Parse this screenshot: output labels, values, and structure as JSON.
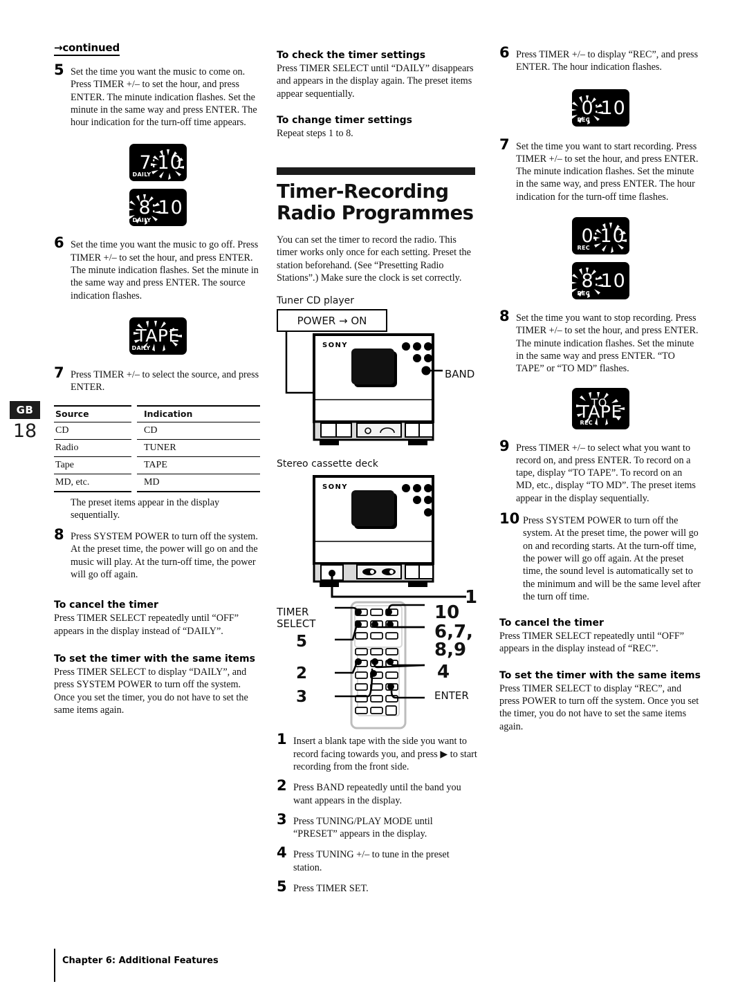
{
  "page": {
    "locale_tab": "GB",
    "number": "18",
    "footer": "Chapter 6: Additional Features"
  },
  "left_column": {
    "continued_label": "→continued",
    "step5": {
      "num": "5",
      "text": "Set the time you want the music to come on.\nPress TIMER +/– to set the hour, and press ENTER.\nThe minute indication flashes.\nSet the minute in the same way and press ENTER.\nThe hour indication for the turn-off time appears."
    },
    "display_710": {
      "hour": "7",
      "colon": ":",
      "minute": "10",
      "tag": "DAILY",
      "flashing": "minute"
    },
    "display_810": {
      "hour": "8",
      "colon": ":",
      "minute": "10",
      "tag": "DAILY",
      "flashing": "hour"
    },
    "step6": {
      "num": "6",
      "text": "Set the time you want the music to go off.\nPress TIMER +/– to set the hour, and press ENTER.\nThe minute indication flashes.\nSet the minute in the same way and press ENTER.\nThe source indication flashes."
    },
    "display_tape": {
      "word": "TAPE",
      "tag": "DAILY",
      "flashing": "word"
    },
    "step7": {
      "num": "7",
      "text": "Press TIMER +/– to select the source, and press ENTER."
    },
    "source_table": {
      "headers": [
        "Source",
        "Indication"
      ],
      "rows": [
        [
          "CD",
          "CD"
        ],
        [
          "Radio",
          "TUNER"
        ],
        [
          "Tape",
          "TAPE"
        ],
        [
          "MD, etc.",
          "MD"
        ]
      ]
    },
    "table_note": "The preset items appear in the display sequentially.",
    "step8": {
      "num": "8",
      "text": "Press SYSTEM POWER to turn off the system.\nAt the preset time, the power will go on and the music will play.  At the turn-off time, the power will go off again."
    },
    "cancel_heading": "To cancel the timer",
    "cancel_body": "Press TIMER SELECT repeatedly until “OFF” appears in the display instead of “DAILY”.",
    "same_items_heading": "To set the timer with the same items",
    "same_items_body": "Press TIMER SELECT to display “DAILY”, and press SYSTEM POWER to turn off the system.\nOnce you set the timer, you do not have to set the same items again."
  },
  "middle_column": {
    "check_heading": "To check the timer settings",
    "check_body": "Press TIMER SELECT until “DAILY” disappears and appears in the display again.\nThe preset items appear sequentially.",
    "change_heading": "To change timer settings",
    "change_body": "Repeat steps 1 to 8.",
    "section_title_line1": "Timer-Recording",
    "section_title_line2": "Radio Programmes",
    "intro": "You can set the timer to record the radio.\nThis timer works only once for each setting.\nPreset the station beforehand.  (See “Presetting Radio Stations”.)\nMake sure the clock is set correctly.",
    "tuner_label": "Tuner CD player",
    "power_box": "POWER → ON",
    "brand": "SONY",
    "band_callout": "BAND",
    "cassette_label": "Stereo cassette deck",
    "remote_callouts": {
      "timer_select_l1": "TIMER",
      "timer_select_l2": "SELECT",
      "five": "5",
      "two": "2",
      "three": "3",
      "ten": "10",
      "six_seven": "6,7,",
      "eight_nine": "8,9",
      "four": "4",
      "enter": "ENTER",
      "one": "1"
    },
    "step1": {
      "num": "1",
      "text": "Insert a blank tape with the side you want to record facing towards you, and press ▶ to start recording from the front side."
    },
    "step2": {
      "num": "2",
      "text": "Press BAND repeatedly until the band you want appears in the display."
    },
    "step3": {
      "num": "3",
      "text": "Press TUNING/PLAY MODE until “PRESET” appears in the display."
    },
    "step4": {
      "num": "4",
      "text": "Press TUNING +/– to tune in the preset station."
    },
    "step5": {
      "num": "5",
      "text": "Press TIMER SET."
    }
  },
  "right_column": {
    "step6": {
      "num": "6",
      "text": "Press TIMER +/– to display “REC”, and press ENTER.\nThe hour indication flashes."
    },
    "display_010_hour": {
      "hour": "0",
      "colon": ":",
      "minute": "10",
      "tag": "REC",
      "flashing": "hour"
    },
    "step7": {
      "num": "7",
      "text": "Set the time you want to start recording.\nPress TIMER +/– to set the hour, and press ENTER.\nThe minute indication flashes.\nSet the minute in the same way, and press ENTER.\nThe hour indication for the turn-off time flashes."
    },
    "display_010_min": {
      "hour": "0",
      "colon": ":",
      "minute": "10",
      "tag": "REC",
      "flashing": "minute"
    },
    "display_810": {
      "hour": "8",
      "colon": ":",
      "minute": "10",
      "tag": "REC",
      "flashing": "hour"
    },
    "step8": {
      "num": "8",
      "text": "Set the time you want to stop recording.\nPress TIMER +/– to set the hour, and press ENTER.\nThe minute indication flashes.\nSet the minute in the same way and press ENTER.\n“TO TAPE” or “TO MD”  flashes."
    },
    "display_totape": {
      "word_top": "TO",
      "word_bottom": "TAPE",
      "tag": "REC",
      "flashing": "word"
    },
    "step9": {
      "num": "9",
      "text": "Press TIMER +/– to select what you want to record on, and press ENTER.\nTo record on a tape, display “TO TAPE”.\nTo record on an MD, etc., display “TO MD”.\nThe preset items appear in the display sequentially."
    },
    "step10": {
      "num": "10",
      "text": "Press SYSTEM POWER to turn off the system.\nAt the preset time, the power will go on and recording starts.  At the turn-off time, the power will go off again.\nAt the preset time, the sound level is automatically set to the minimum and will be the same level after the turn off time."
    },
    "cancel_heading": "To cancel the timer",
    "cancel_body": "Press TIMER SELECT repeatedly until “OFF” appears in the display instead of “REC”.",
    "same_items_heading": "To set the timer with the same items",
    "same_items_body": "Press TIMER SELECT to display “REC”, and press POWER to turn off the system.\nOnce you set the timer, you do not have to set the same items again."
  },
  "colors": {
    "ink": "#111111",
    "lcd_background": "#000000",
    "lcd_text": "#ffffff",
    "tab_background": "#1c1c1c"
  }
}
